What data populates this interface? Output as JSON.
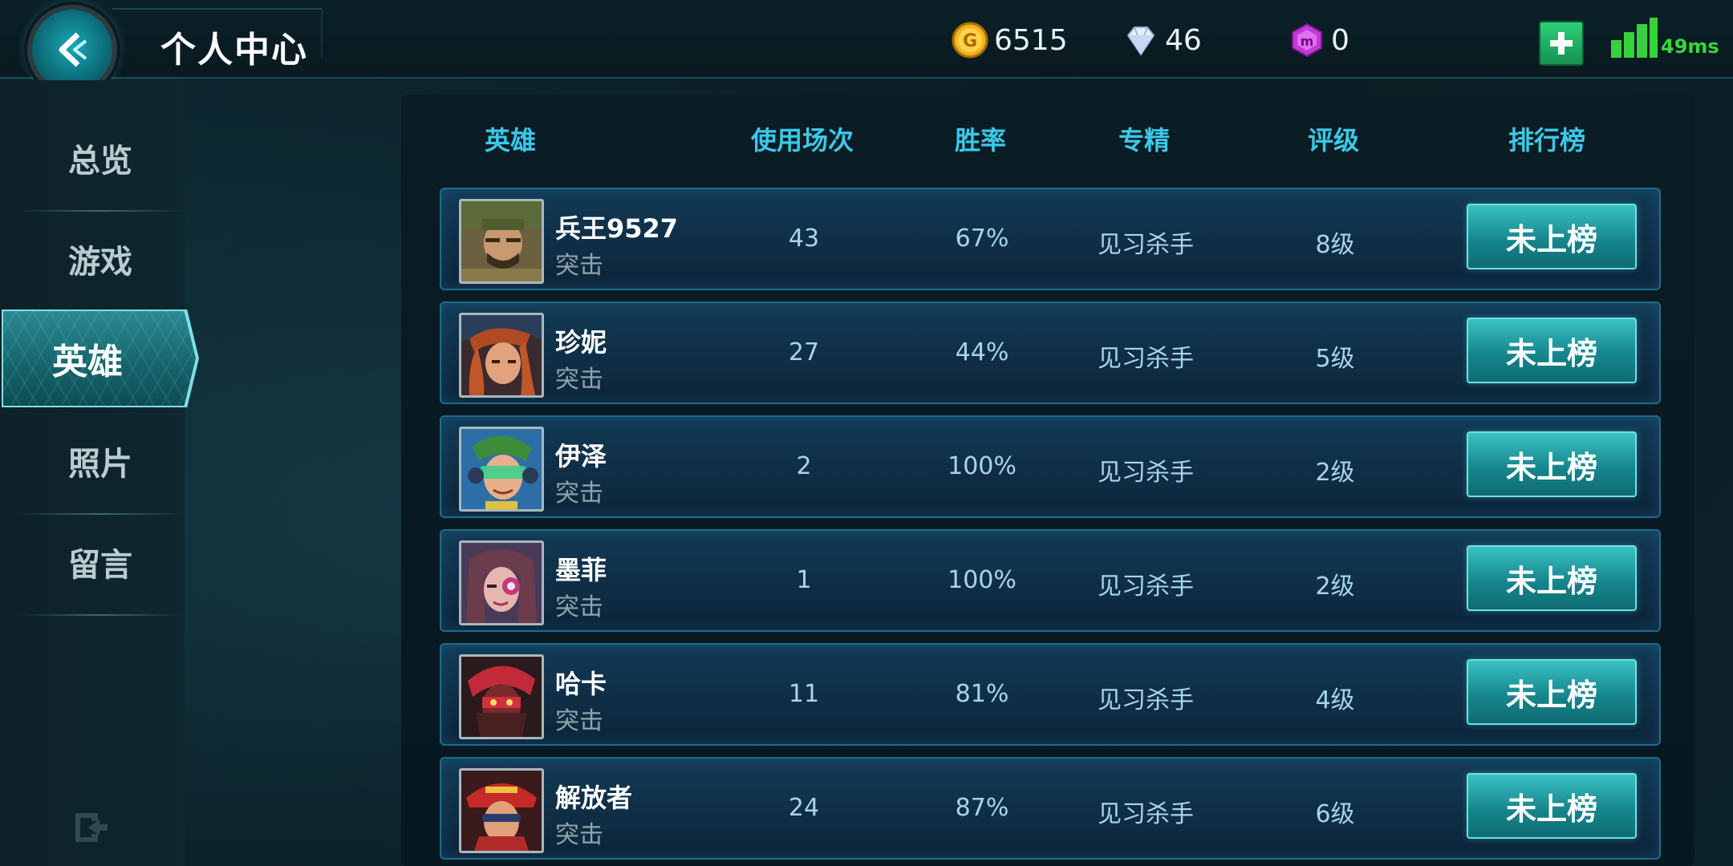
{
  "header": {
    "title": "个人中心",
    "gold": "6515",
    "diamonds": "46",
    "purple_gems": "0",
    "ping": "49ms"
  },
  "sidebar": {
    "items": [
      {
        "label": "总览"
      },
      {
        "label": "游戏"
      },
      {
        "label": "英雄",
        "active": true
      },
      {
        "label": "照片"
      },
      {
        "label": "留言"
      }
    ]
  },
  "table": {
    "columns": [
      "英雄",
      "使用场次",
      "胜率",
      "专精",
      "评级",
      "排行榜"
    ],
    "rows": [
      {
        "name": "兵王9527",
        "role": "突击",
        "matches": "43",
        "win_rate": "67%",
        "mastery": "见习杀手",
        "grade": "8级",
        "rank": "未上榜"
      },
      {
        "name": "珍妮",
        "role": "突击",
        "matches": "27",
        "win_rate": "44%",
        "mastery": "见习杀手",
        "grade": "5级",
        "rank": "未上榜"
      },
      {
        "name": "伊泽",
        "role": "突击",
        "matches": "2",
        "win_rate": "100%",
        "mastery": "见习杀手",
        "grade": "2级",
        "rank": "未上榜"
      },
      {
        "name": "墨菲",
        "role": "突击",
        "matches": "1",
        "win_rate": "100%",
        "mastery": "见习杀手",
        "grade": "2级",
        "rank": "未上榜"
      },
      {
        "name": "哈卡",
        "role": "突击",
        "matches": "11",
        "win_rate": "81%",
        "mastery": "见习杀手",
        "grade": "4级",
        "rank": "未上榜"
      },
      {
        "name": "解放者",
        "role": "突击",
        "matches": "24",
        "win_rate": "87%",
        "mastery": "见习杀手",
        "grade": "6级",
        "rank": "未上榜"
      }
    ]
  },
  "icons": {
    "back": "back-arrow-icon",
    "gold": "gold-coin-icon",
    "diamond": "diamond-icon",
    "purple": "purple-gem-icon",
    "plus": "plus-icon",
    "signal": "signal-icon",
    "exit": "exit-icon"
  },
  "colors": {
    "header_text": "#3cc8e8",
    "active_tab": "#186870",
    "rank_button": "#16878d",
    "ping_green": "#39d63c"
  }
}
